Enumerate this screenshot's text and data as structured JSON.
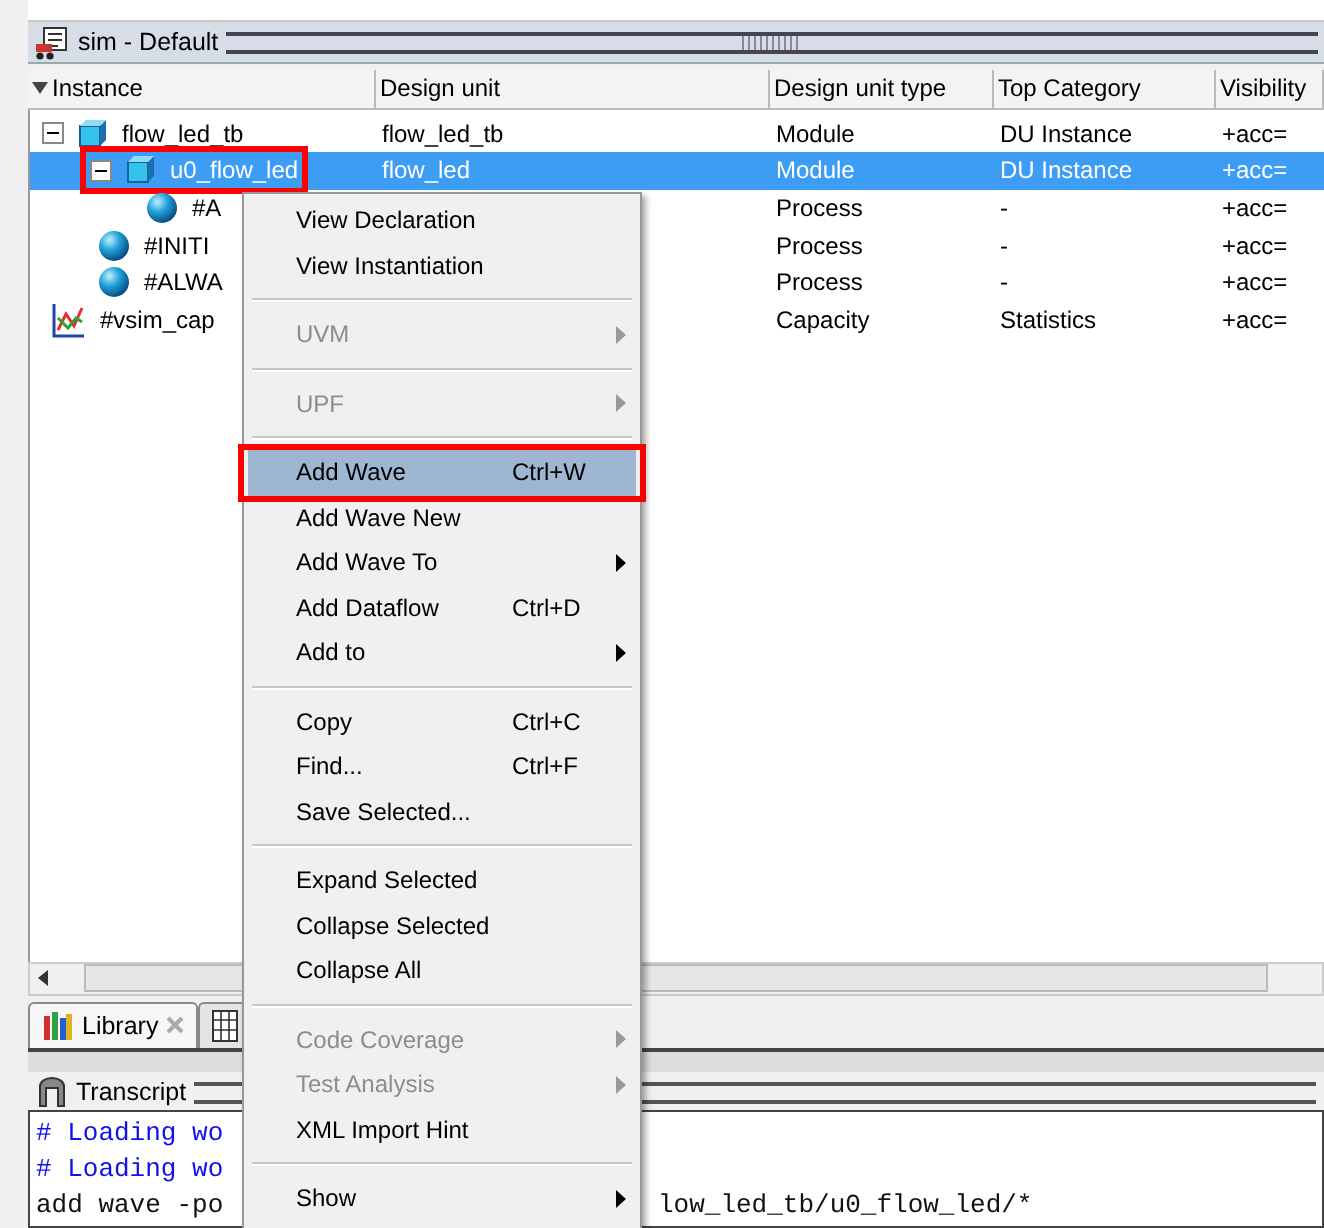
{
  "panel": {
    "title": "sim - Default"
  },
  "columns": [
    "Instance",
    "Design unit",
    "Design unit type",
    "Top Category",
    "Visibility"
  ],
  "tree": [
    {
      "name": "flow_led_tb",
      "kind": "module",
      "expanded": true,
      "selected": false,
      "annotated": false,
      "design_unit": "flow_led_tb",
      "unit_type": "Module",
      "category": "DU Instance",
      "visibility": "+acc=",
      "children": [
        {
          "name": "u0_flow_led",
          "kind": "module",
          "expanded": true,
          "selected": true,
          "annotated": true,
          "design_unit": "flow_led",
          "unit_type": "Module",
          "category": "DU Instance",
          "visibility": "+acc=",
          "children": [
            {
              "name": "#A",
              "kind": "process",
              "selected": false,
              "annotated": false,
              "unit_type": "Process",
              "category": "-",
              "visibility": "+acc="
            }
          ]
        },
        {
          "name": "#INITI",
          "kind": "process",
          "selected": false,
          "annotated": false,
          "unit_type": "Process",
          "category": "-",
          "visibility": "+acc="
        },
        {
          "name": "#ALWA",
          "kind": "process",
          "selected": false,
          "annotated": false,
          "unit_type": "Process",
          "category": "-",
          "visibility": "+acc="
        }
      ]
    },
    {
      "name": "#vsim_cap",
      "kind": "capacity",
      "selected": false,
      "annotated": false,
      "unit_type": "Capacity",
      "category": "Statistics",
      "visibility": "+acc="
    }
  ],
  "tabs": [
    {
      "label": "Library",
      "kind": "library",
      "selected": true,
      "closable": true
    },
    {
      "kind": "structure",
      "selected": false
    }
  ],
  "transcript": {
    "title": "Transcript",
    "lines": [
      {
        "kind": "comment",
        "text": "# Loading wo"
      },
      {
        "kind": "comment",
        "text": "# Loading wo"
      },
      {
        "kind": "command",
        "text": "add wave -po",
        "tail": "low_led_tb/u0_flow_led/*"
      }
    ]
  },
  "menu": [
    {
      "kind": "item",
      "label": "View Declaration",
      "disabled": false,
      "submenu": false,
      "highlighted": false,
      "annotated": false
    },
    {
      "kind": "item",
      "label": "View Instantiation",
      "disabled": false,
      "submenu": false,
      "highlighted": false,
      "annotated": false
    },
    {
      "kind": "separator"
    },
    {
      "kind": "item",
      "label": "UVM",
      "disabled": true,
      "submenu": true,
      "highlighted": false,
      "annotated": false
    },
    {
      "kind": "separator"
    },
    {
      "kind": "item",
      "label": "UPF",
      "disabled": true,
      "submenu": true,
      "highlighted": false,
      "annotated": false
    },
    {
      "kind": "separator"
    },
    {
      "kind": "item",
      "label": "Add Wave",
      "shortcut": "Ctrl+W",
      "disabled": false,
      "submenu": false,
      "highlighted": true,
      "annotated": true
    },
    {
      "kind": "item",
      "label": "Add Wave New",
      "disabled": false,
      "submenu": false,
      "highlighted": false,
      "annotated": false
    },
    {
      "kind": "item",
      "label": "Add Wave To",
      "disabled": false,
      "submenu": true,
      "highlighted": false,
      "annotated": false
    },
    {
      "kind": "item",
      "label": "Add Dataflow",
      "shortcut": "Ctrl+D",
      "disabled": false,
      "submenu": false,
      "highlighted": false,
      "annotated": false
    },
    {
      "kind": "item",
      "label": "Add to",
      "disabled": false,
      "submenu": true,
      "highlighted": false,
      "annotated": false
    },
    {
      "kind": "separator"
    },
    {
      "kind": "item",
      "label": "Copy",
      "shortcut": "Ctrl+C",
      "disabled": false,
      "submenu": false,
      "highlighted": false,
      "annotated": false
    },
    {
      "kind": "item",
      "label": "Find...",
      "shortcut": "Ctrl+F",
      "disabled": false,
      "submenu": false,
      "highlighted": false,
      "annotated": false
    },
    {
      "kind": "item",
      "label": "Save Selected...",
      "disabled": false,
      "submenu": false,
      "highlighted": false,
      "annotated": false
    },
    {
      "kind": "separator"
    },
    {
      "kind": "item",
      "label": "Expand Selected",
      "disabled": false,
      "submenu": false,
      "highlighted": false,
      "annotated": false
    },
    {
      "kind": "item",
      "label": "Collapse Selected",
      "disabled": false,
      "submenu": false,
      "highlighted": false,
      "annotated": false
    },
    {
      "kind": "item",
      "label": "Collapse All",
      "disabled": false,
      "submenu": false,
      "highlighted": false,
      "annotated": false
    },
    {
      "kind": "separator"
    },
    {
      "kind": "item",
      "label": "Code Coverage",
      "disabled": true,
      "submenu": true,
      "highlighted": false,
      "annotated": false
    },
    {
      "kind": "item",
      "label": "Test Analysis",
      "disabled": true,
      "submenu": true,
      "highlighted": false,
      "annotated": false
    },
    {
      "kind": "item",
      "label": "XML Import Hint",
      "disabled": false,
      "submenu": false,
      "highlighted": false,
      "annotated": false
    },
    {
      "kind": "separator"
    },
    {
      "kind": "item",
      "label": "Show",
      "disabled": false,
      "submenu": true,
      "highlighted": false,
      "annotated": false
    }
  ]
}
